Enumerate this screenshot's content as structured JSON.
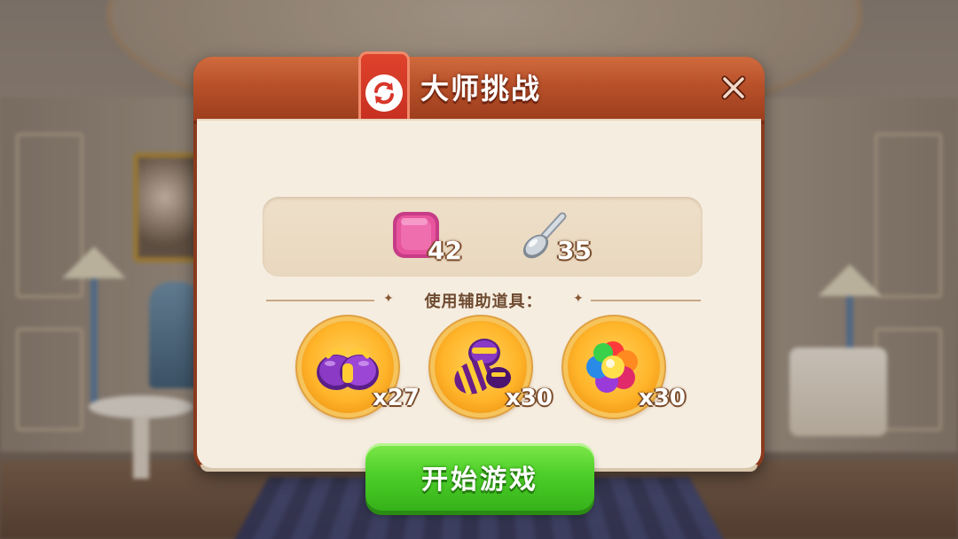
{
  "dialog": {
    "title": "大师挑战",
    "close_label": "✕"
  },
  "resources": [
    {
      "icon": "pink-tile-icon",
      "count": "42"
    },
    {
      "icon": "spoon-icon",
      "count": "35"
    }
  ],
  "boosters_header": "使用辅助道具：",
  "boosters": [
    {
      "icon": "purple-bomb-icon",
      "count": "x27"
    },
    {
      "icon": "striped-candy-icon",
      "count": "x30"
    },
    {
      "icon": "rainbow-ball-icon",
      "count": "x30"
    }
  ],
  "play_button": {
    "label": "开始游戏"
  },
  "colors": {
    "header": "#b8512a",
    "body": "#f5ede0",
    "play_green": "#4ecf2a",
    "ribbon_red": "#d8362a"
  }
}
